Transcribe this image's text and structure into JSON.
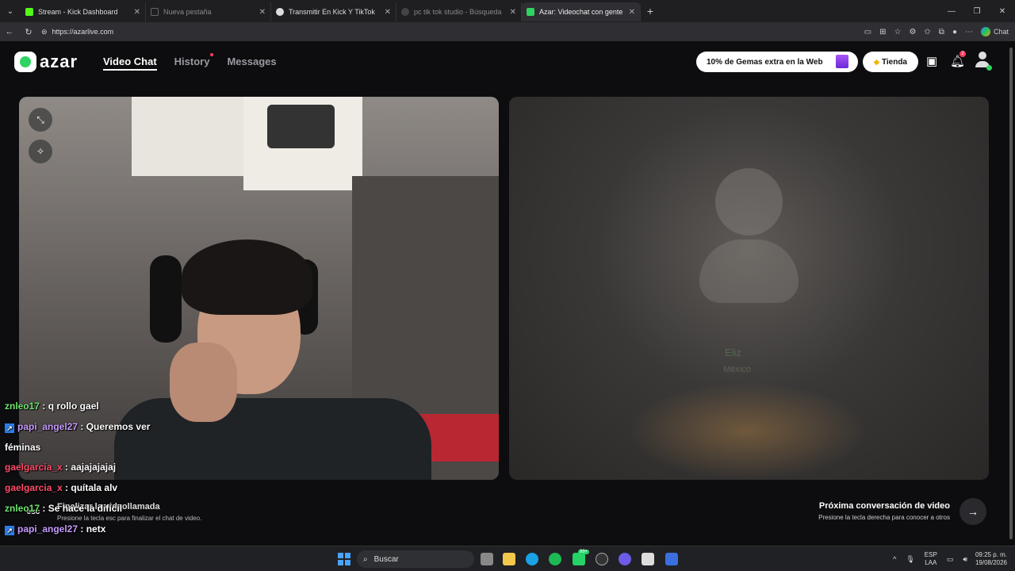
{
  "browser": {
    "tabs": [
      {
        "title": "Stream - Kick Dashboard",
        "state": "normal",
        "color": "#53fc18"
      },
      {
        "title": "Nueva pestaña",
        "state": "inactive",
        "color": "#666666"
      },
      {
        "title": "Transmitir En Kick Y TikTok",
        "state": "normal",
        "color": "#dddddd"
      },
      {
        "title": "pc tik tok studio - Búsqueda",
        "state": "inactive",
        "color": "#444444"
      },
      {
        "title": "Azar: Videochat con gente nu",
        "state": "active",
        "color": "#2fd35f"
      }
    ],
    "url": "https://azarlive.com",
    "copilot_label": "Chat"
  },
  "app": {
    "logo_text": "azar",
    "nav": {
      "video_chat": "Video Chat",
      "history": "History",
      "messages": "Messages"
    },
    "promo_text": "10% de Gemas extra en la Web",
    "store_label": "Tienda",
    "notification_count": "2"
  },
  "chat_overlay": [
    {
      "user": "znleo17",
      "text": "q rollo gael",
      "user_color": "green",
      "badge": false
    },
    {
      "user": "papi_angel27",
      "text": "Queremos ver",
      "user_color": "purple",
      "badge": true
    },
    {
      "user": "",
      "text": "féminas",
      "user_color": "none",
      "badge": false
    },
    {
      "user": "gaelgarcia_x",
      "text": "aajajajajaj",
      "user_color": "red",
      "badge": false
    },
    {
      "user": "gaelgarcia_x",
      "text": "quítala alv",
      "user_color": "red",
      "badge": false
    },
    {
      "user": "znleo17",
      "text": "Se hace la difícil",
      "user_color": "green",
      "badge": false
    },
    {
      "user": "papi_angel27",
      "text": "netx",
      "user_color": "purple",
      "badge": true
    }
  ],
  "controls": {
    "esc_key": "esc",
    "end_title": "Finalizar la videollamada",
    "end_sub": "Presione la tecla esc para finalizar el chat de video.",
    "next_title": "Próxima conversación de video",
    "next_sub": "Presione la tecla derecha para conocer a otros"
  },
  "remote_video": {
    "blurred_name": "Eliz",
    "blurred_location": "México"
  },
  "taskbar": {
    "search_placeholder": "Buscar",
    "lang_top": "ESP",
    "lang_bottom": "LAA",
    "time": "09:25 p. m.",
    "date": "19/08/2026",
    "whatsapp_badge": "99+"
  }
}
